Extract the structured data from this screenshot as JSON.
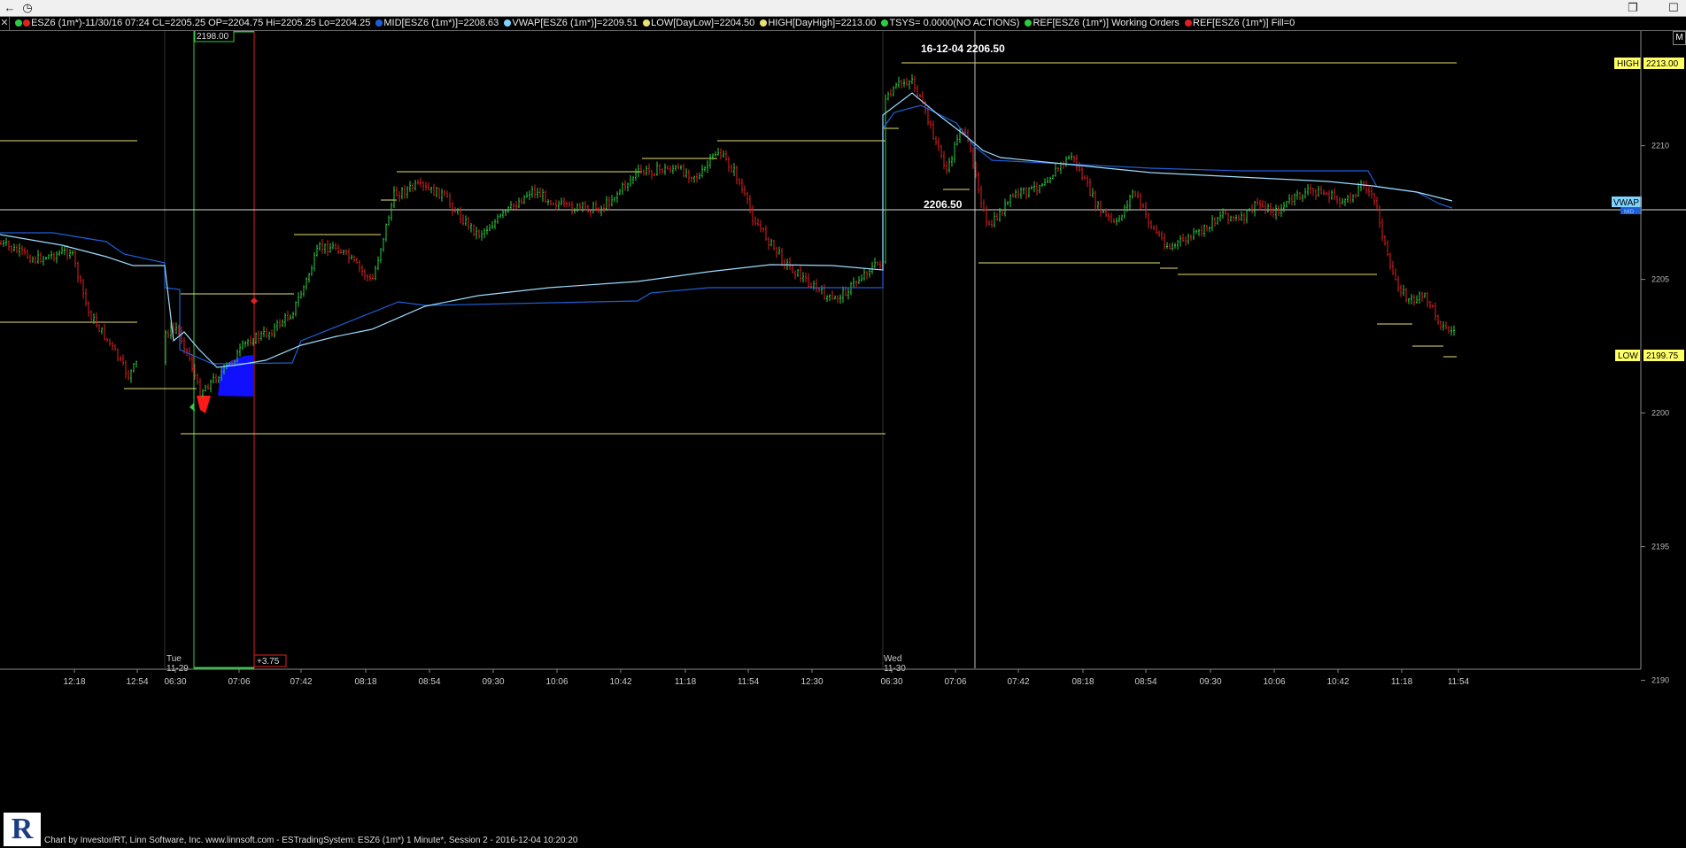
{
  "window": {
    "back_label": "←",
    "clock_label": "◷",
    "restore_label": "❐",
    "maximize_label": "☐"
  },
  "legend": {
    "close_label": "✕",
    "items": [
      {
        "text": "ESZ6 (1m*)-11/30/16 07:24 CL=2205.25 OP=2204.75 Hi=2205.25 Lo=2204.25",
        "color": "#2ecc40",
        "color2": "#e02020"
      },
      {
        "text": "MID[ESZ6 (1m*)]=2208.63",
        "color": "#1e5fd8"
      },
      {
        "text": "VWAP[ESZ6 (1m*)]=2209.51",
        "color": "#7fd4ff"
      },
      {
        "text": "LOW[DayLow]=2204.50",
        "color": "#e8e070"
      },
      {
        "text": "HIGH[DayHigh]=2213.00",
        "color": "#e8e070"
      },
      {
        "text": "TSYS=  0.0000(NO ACTIONS)",
        "color": "#2ecc40"
      },
      {
        "text": "REF[ESZ6 (1m*)] Working Orders",
        "color": "#2ecc40"
      },
      {
        "text": "REF[ESZ6 (1m*)] Fill=0",
        "color": "#e02020"
      }
    ]
  },
  "chart": {
    "cursor_label": "16-12-04  2206.50",
    "crosshair_price": "2206.50",
    "box_top_label": "2198.00",
    "box_bottom_label": "+3.75",
    "high_tag": "HIGH",
    "high_value": "2213.00",
    "low_tag": "LOW",
    "low_value": "2199.75",
    "vwap_tag": "VWAP",
    "mid_tag": "MID",
    "day1_label_a": "Tue",
    "day1_label_b": "11-29",
    "day2_label_a": "Wed",
    "day2_label_b": "11-30",
    "m_button": "M"
  },
  "chart_data": {
    "type": "line",
    "title": "",
    "xlabel": "",
    "ylabel": "",
    "ylim": [
      2187.5,
      2215.5
    ],
    "y_ticks": [
      "2210",
      "2205",
      "2200",
      "2195",
      "2190"
    ],
    "x_ticks": [
      "12:18",
      "12:54",
      "06:30",
      "07:06",
      "07:42",
      "08:18",
      "08:54",
      "09:30",
      "10:06",
      "10:42",
      "11:18",
      "11:54",
      "12:30",
      "06:30",
      "07:06",
      "07:42",
      "08:18",
      "08:54",
      "09:30",
      "10:06",
      "10:42",
      "11:18",
      "11:54"
    ],
    "colors": {
      "up": "#2ecc40",
      "down": "#e02020",
      "mid": "#1e5fd8",
      "vwap": "#9fdcff",
      "level": "#e8e070"
    }
  },
  "footer": {
    "text": "Chart by Investor/RT, Linn Software, Inc. www.linnsoft.com - ESTradingSystem: ESZ6 (1m*) 1 Minute*, Session 2 - 2016-12-04 10:20:20",
    "logo": "R"
  }
}
